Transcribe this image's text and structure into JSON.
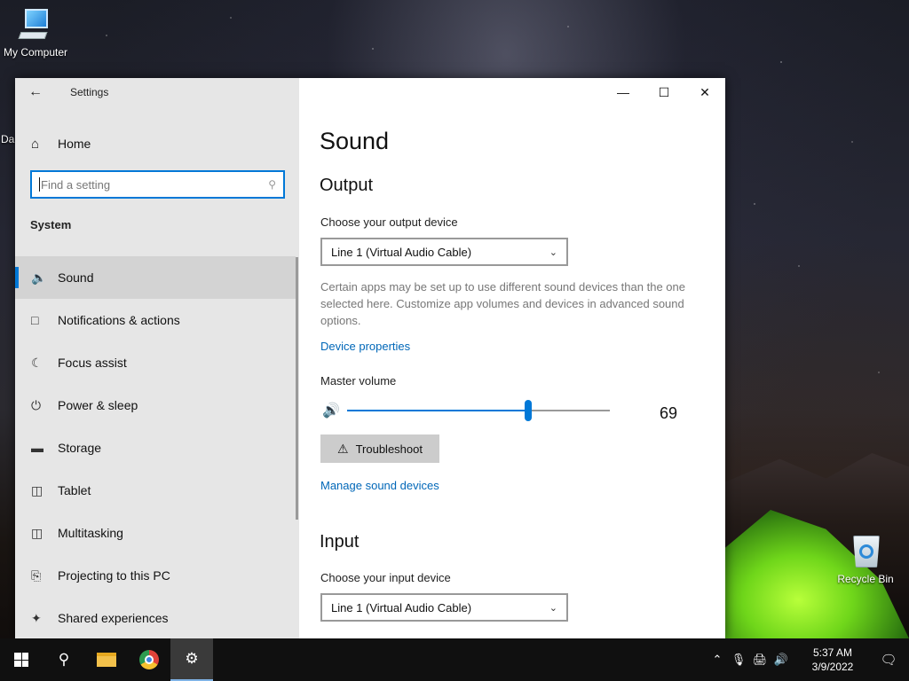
{
  "desktop": {
    "icons": [
      {
        "label": "My Computer"
      },
      {
        "label": "Recycle Bin"
      },
      {
        "label": "Da"
      }
    ]
  },
  "window": {
    "app_title": "Settings",
    "controls": {
      "minimize": "—",
      "maximize": "☐",
      "close": "✕"
    }
  },
  "sidebar": {
    "home_label": "Home",
    "search_placeholder": "Find a setting",
    "section_title": "System",
    "items": [
      {
        "label": "Sound",
        "icon": "speaker-icon",
        "active": true
      },
      {
        "label": "Notifications & actions",
        "icon": "notification-icon"
      },
      {
        "label": "Focus assist",
        "icon": "moon-icon"
      },
      {
        "label": "Power & sleep",
        "icon": "power-icon"
      },
      {
        "label": "Storage",
        "icon": "storage-icon"
      },
      {
        "label": "Tablet",
        "icon": "tablet-icon"
      },
      {
        "label": "Multitasking",
        "icon": "multitasking-icon"
      },
      {
        "label": "Projecting to this PC",
        "icon": "projecting-icon"
      },
      {
        "label": "Shared experiences",
        "icon": "shared-icon"
      }
    ]
  },
  "content": {
    "page_title": "Sound",
    "output": {
      "heading": "Output",
      "device_label": "Choose your output device",
      "device_value": "Line 1 (Virtual Audio Cable)",
      "description": "Certain apps may be set up to use different sound devices than the one selected here. Customize app volumes and devices in advanced sound options.",
      "device_properties_link": "Device properties",
      "master_volume_label": "Master volume",
      "volume": 69,
      "troubleshoot_label": "Troubleshoot",
      "manage_devices_link": "Manage sound devices"
    },
    "input": {
      "heading": "Input",
      "device_label": "Choose your input device",
      "device_value": "Line 1 (Virtual Audio Cable)"
    }
  },
  "taskbar": {
    "time": "5:37 AM",
    "date": "3/9/2022"
  },
  "colors": {
    "accent": "#0078d7",
    "link": "#0067b8"
  }
}
